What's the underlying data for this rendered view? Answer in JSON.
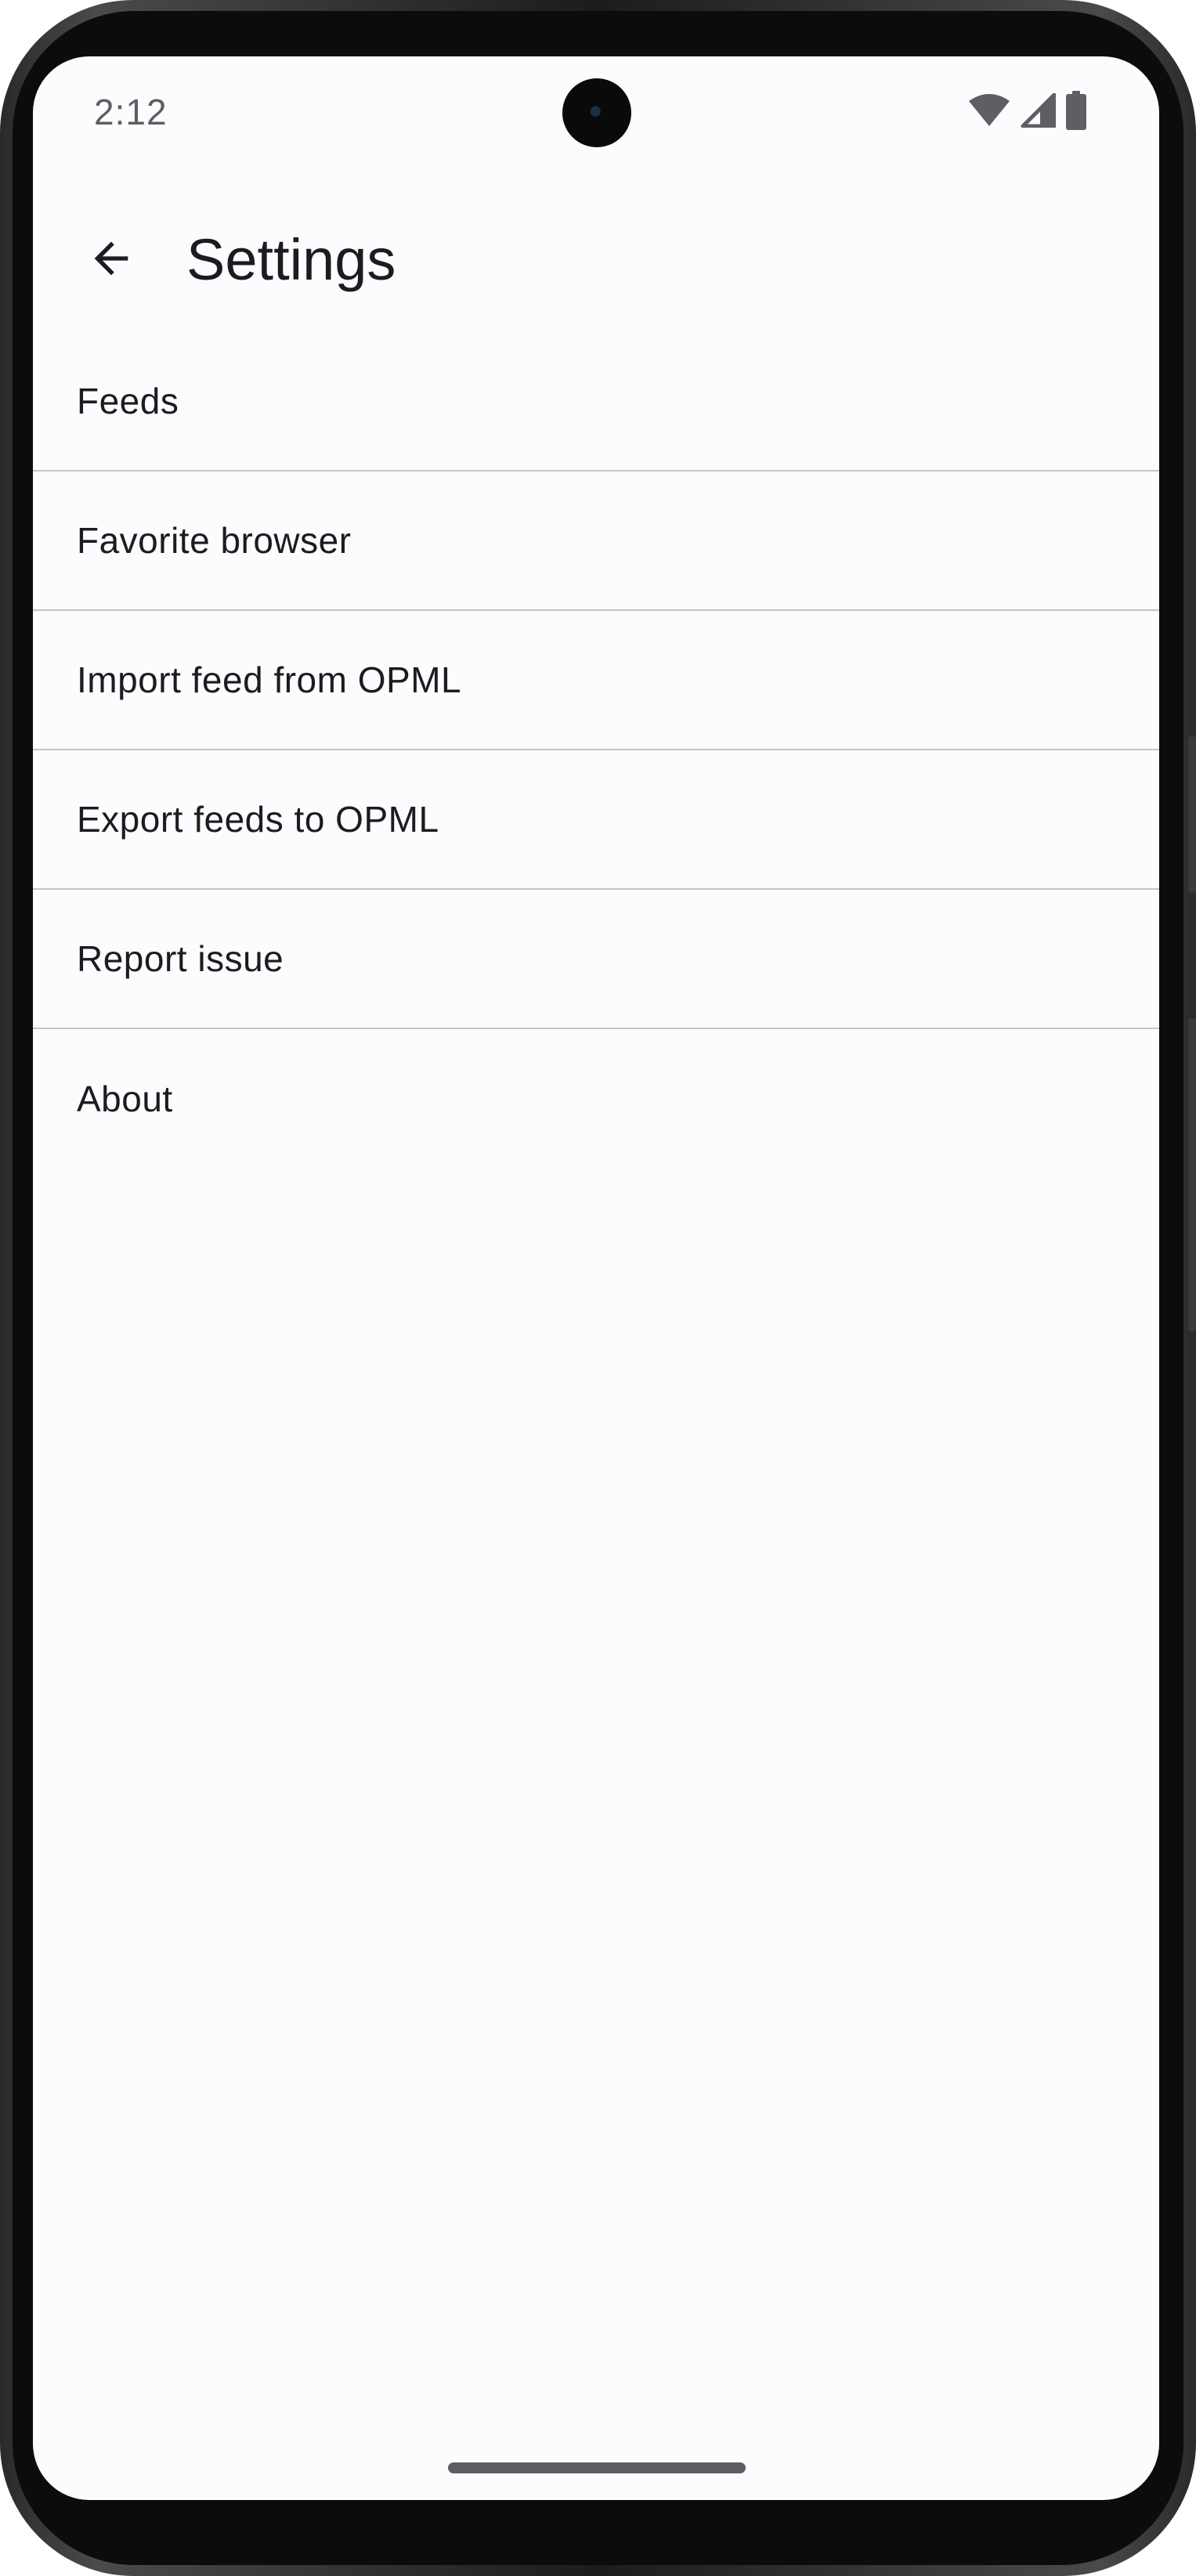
{
  "status_bar": {
    "time": "2:12",
    "icons": [
      "wifi-icon",
      "cellular-signal-icon",
      "battery-icon"
    ]
  },
  "app_bar": {
    "back_icon": "arrow-back-icon",
    "title": "Settings"
  },
  "settings_items": [
    {
      "label": "Feeds"
    },
    {
      "label": "Favorite browser"
    },
    {
      "label": "Import feed from OPML"
    },
    {
      "label": "Export feeds to OPML"
    },
    {
      "label": "Report issue"
    },
    {
      "label": "About"
    }
  ],
  "colors": {
    "background": "#fcfbfd",
    "text": "#1c1b1f",
    "divider": "#c7c5ca",
    "status_text": "#5f5e62"
  }
}
